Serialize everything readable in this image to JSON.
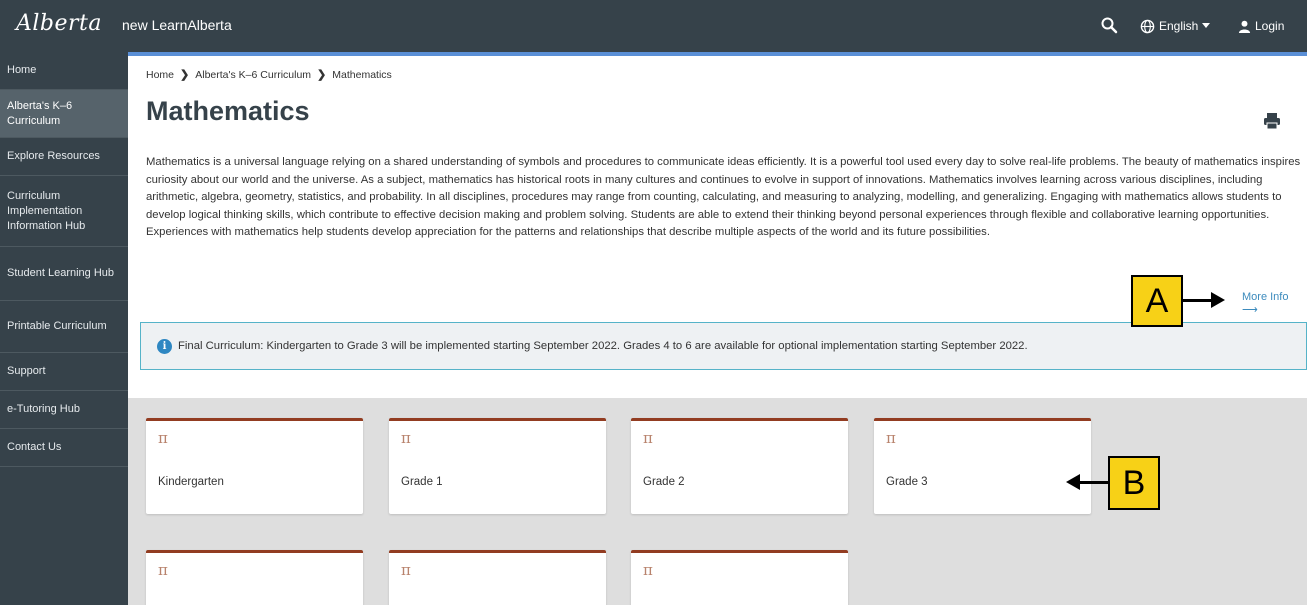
{
  "header": {
    "logo_text": "Alberta",
    "app_title": "new LearnAlberta",
    "language_label": "English",
    "login_label": "Login"
  },
  "sidebar": {
    "items": [
      {
        "label": "Home"
      },
      {
        "label": "Alberta's K–6 Curriculum"
      },
      {
        "label": "Explore Resources"
      },
      {
        "label": "Curriculum Implementation Information Hub"
      },
      {
        "label": "Student Learning Hub"
      },
      {
        "label": "Printable Curriculum"
      },
      {
        "label": "Support"
      },
      {
        "label": "e-Tutoring Hub"
      },
      {
        "label": "Contact Us"
      }
    ]
  },
  "breadcrumb": {
    "items": [
      "Home",
      "Alberta's K–6 Curriculum",
      "Mathematics"
    ]
  },
  "page": {
    "title": "Mathematics",
    "intro": "Mathematics is a universal language relying on a shared understanding of symbols and procedures to communicate ideas efficiently. It is a powerful tool used every day to solve real-life problems. The beauty of mathematics inspires curiosity about our world and the universe. As a subject, mathematics has historical roots in many cultures and continues to evolve in support of innovations. Mathematics involves learning across various disciplines, including arithmetic, algebra, geometry, statistics, and probability. In all disciplines, procedures may range from counting, calculating, and measuring to analyzing, modelling, and generalizing. Engaging with mathematics allows students to develop logical thinking skills, which contribute to effective decision making and problem solving. Students are able to extend their thinking beyond personal experiences through flexible and collaborative learning opportunities. Experiences with mathematics help students develop appreciation for the patterns and relationships that describe multiple aspects of the world and its future possibilities.",
    "more_info": "More Info",
    "notice": "Final Curriculum: Kindergarten to Grade 3 will be implemented starting September 2022. Grades 4 to 6 are available for optional implementation starting September 2022."
  },
  "cards": [
    {
      "symbol": "π",
      "label": "Kindergarten"
    },
    {
      "symbol": "π",
      "label": "Grade 1"
    },
    {
      "symbol": "π",
      "label": "Grade 2"
    },
    {
      "symbol": "π",
      "label": "Grade 3"
    },
    {
      "symbol": "π",
      "label": ""
    },
    {
      "symbol": "π",
      "label": ""
    },
    {
      "symbol": "π",
      "label": ""
    }
  ],
  "annotations": {
    "a": "A",
    "b": "B"
  },
  "colors": {
    "topbar": "#36424a",
    "accent": "#5a8fd6",
    "card_border": "#923c21",
    "link": "#3c8bbd",
    "callout": "#f7d117"
  }
}
